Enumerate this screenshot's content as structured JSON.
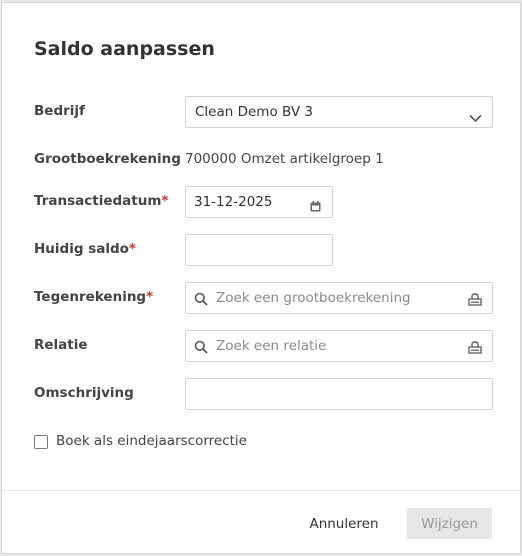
{
  "dialog": {
    "title": "Saldo aanpassen"
  },
  "form": {
    "bedrijf": {
      "label": "Bedrijf",
      "value": "Clean Demo BV 3"
    },
    "grootboekrekening": {
      "label": "Grootboekrekening",
      "value": "700000 Omzet artikelgroep 1"
    },
    "transactiedatum": {
      "label": "Transactiedatum",
      "required_mark": "*",
      "value": "31-12-2025"
    },
    "huidig_saldo": {
      "label": "Huidig saldo",
      "required_mark": "*",
      "value": ""
    },
    "tegenrekening": {
      "label": "Tegenrekening",
      "required_mark": "*",
      "placeholder": "Zoek een grootboekrekening"
    },
    "relatie": {
      "label": "Relatie",
      "placeholder": "Zoek een relatie"
    },
    "omschrijving": {
      "label": "Omschrijving",
      "value": ""
    },
    "eindejaarscorrectie": {
      "label": "Boek als eindejaarscorrectie",
      "checked": false
    }
  },
  "footer": {
    "cancel_label": "Annuleren",
    "submit_label": "Wijzigen"
  },
  "colors": {
    "required": "#c0392b",
    "disabled_button_bg": "#e6e6e6",
    "disabled_button_text": "#9a9a9a"
  },
  "icons": {
    "select": "chevron-down-icon",
    "date": "calendar-icon",
    "search": "search-icon",
    "lookup": "bank-icon"
  }
}
